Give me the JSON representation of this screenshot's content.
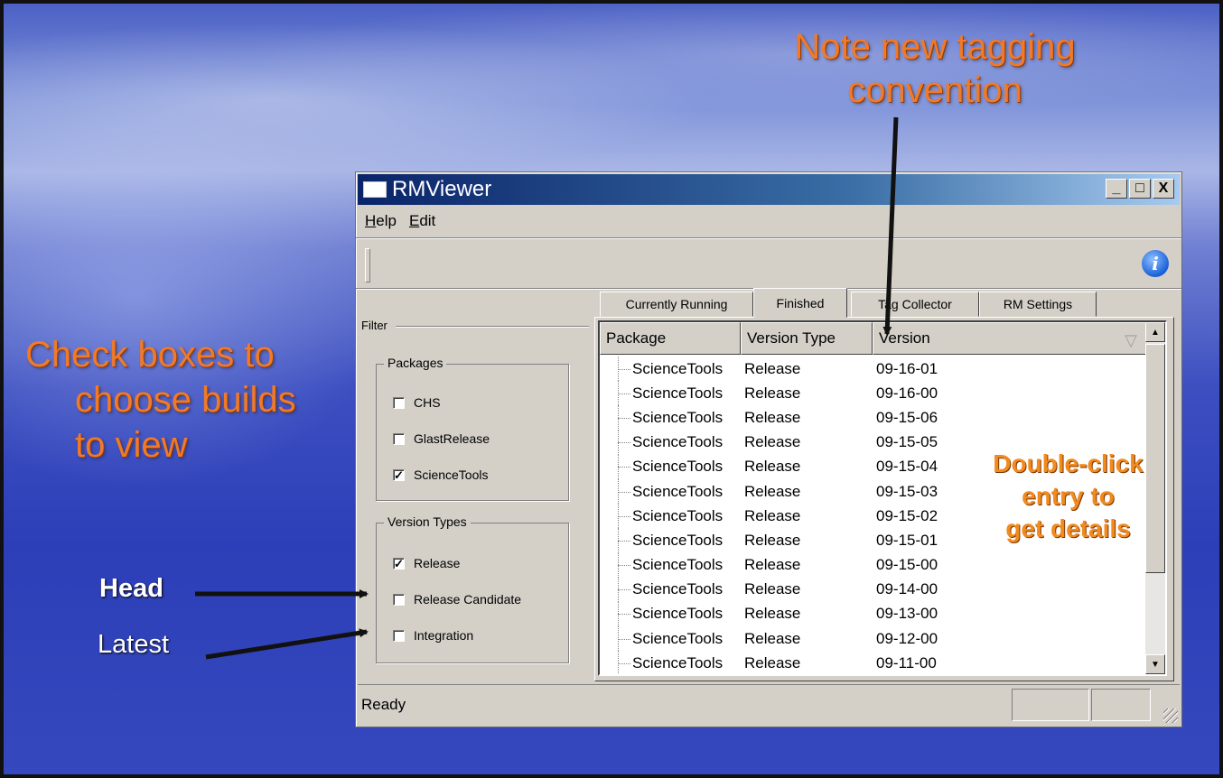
{
  "slide": {
    "note": "Note new tagging convention",
    "checkbox_note": [
      "Check boxes to",
      "choose builds",
      "to view"
    ],
    "head_label": "Head",
    "latest_label": "Latest",
    "double_click_note": [
      "Double-click",
      "entry to",
      "get details"
    ]
  },
  "window": {
    "title": "RMViewer",
    "controls": {
      "minimize": "_",
      "maximize": "□",
      "close": "X"
    },
    "menu": [
      "Help",
      "Edit"
    ],
    "info_icon_label": "i"
  },
  "filter": {
    "label": "Filter",
    "packages": {
      "title": "Packages",
      "items": [
        {
          "label": "CHS",
          "checked": false
        },
        {
          "label": "GlastRelease",
          "checked": false
        },
        {
          "label": "ScienceTools",
          "checked": true
        }
      ]
    },
    "version_types": {
      "title": "Version Types",
      "items": [
        {
          "label": "Release",
          "checked": true
        },
        {
          "label": "Release Candidate",
          "checked": false
        },
        {
          "label": "Integration",
          "checked": false
        }
      ]
    }
  },
  "tabs": [
    {
      "label": "Currently Running",
      "active": false
    },
    {
      "label": "Finished",
      "active": true
    },
    {
      "label": "Tag Collector",
      "active": false
    },
    {
      "label": "RM Settings",
      "active": false
    }
  ],
  "table": {
    "columns": [
      "Package",
      "Version Type",
      "Version"
    ],
    "rows": [
      [
        "ScienceTools",
        "Release",
        "09-16-01"
      ],
      [
        "ScienceTools",
        "Release",
        "09-16-00"
      ],
      [
        "ScienceTools",
        "Release",
        "09-15-06"
      ],
      [
        "ScienceTools",
        "Release",
        "09-15-05"
      ],
      [
        "ScienceTools",
        "Release",
        "09-15-04"
      ],
      [
        "ScienceTools",
        "Release",
        "09-15-03"
      ],
      [
        "ScienceTools",
        "Release",
        "09-15-02"
      ],
      [
        "ScienceTools",
        "Release",
        "09-15-01"
      ],
      [
        "ScienceTools",
        "Release",
        "09-15-00"
      ],
      [
        "ScienceTools",
        "Release",
        "09-14-00"
      ],
      [
        "ScienceTools",
        "Release",
        "09-13-00"
      ],
      [
        "ScienceTools",
        "Release",
        "09-12-00"
      ],
      [
        "ScienceTools",
        "Release",
        "09-11-00"
      ]
    ]
  },
  "status": {
    "text": "Ready"
  },
  "colors": {
    "annotation_orange": "#f07a2a",
    "titlebar_dark": "#0a246a",
    "titlebar_light": "#a6caf0",
    "window_face": "#d4d0c8"
  },
  "icons": {
    "sort": "sort-descending-icon",
    "info": "info-icon"
  }
}
